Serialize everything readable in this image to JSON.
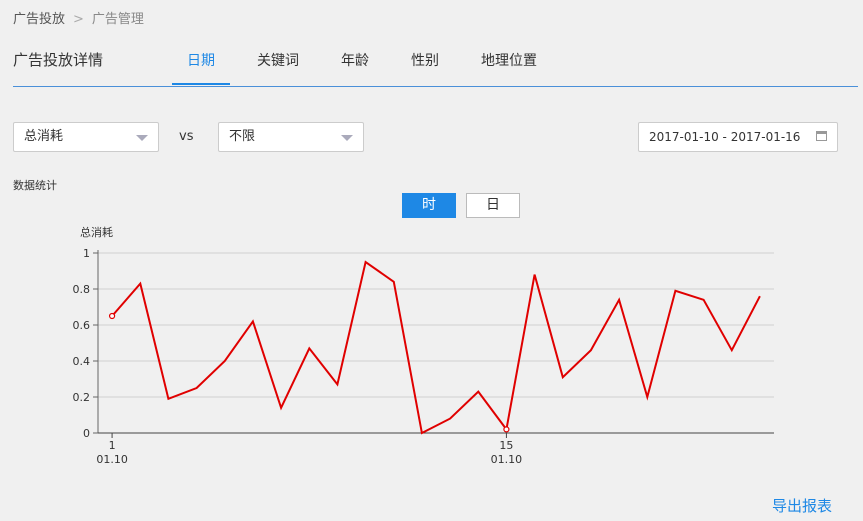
{
  "breadcrumb": {
    "root": "广告投放",
    "separator": ">",
    "current": "广告管理"
  },
  "page_title": "广告投放详情",
  "tabs": [
    {
      "label": "日期",
      "active": true
    },
    {
      "label": "关键词",
      "active": false
    },
    {
      "label": "年龄",
      "active": false
    },
    {
      "label": "性别",
      "active": false
    },
    {
      "label": "地理位置",
      "active": false
    }
  ],
  "filters": {
    "metric_a": "总消耗",
    "vs_label": "vs",
    "metric_b": "不限",
    "date_range": "2017-01-10 - 2017-01-16"
  },
  "section_label": "数据统计",
  "granularity": {
    "hour": "时",
    "day": "日",
    "selected": "时"
  },
  "export_label": "导出报表",
  "colors": {
    "accent": "#1e88e5",
    "series": "#e00000"
  },
  "chart_data": {
    "type": "line",
    "ylabel": "总消耗",
    "ylim": [
      0,
      1
    ],
    "yticks": [
      0,
      0.2,
      0.4,
      0.6,
      0.8,
      1
    ],
    "ytick_labels": [
      "0",
      "0.2",
      "0.4",
      "0.6",
      "0.8",
      "1"
    ],
    "x": [
      1,
      2,
      3,
      4,
      5,
      6,
      7,
      8,
      9,
      10,
      11,
      12,
      13,
      14,
      15,
      16,
      17,
      18,
      19,
      20,
      21,
      22,
      23,
      24
    ],
    "xlim": [
      0.5,
      24.5
    ],
    "xtick_labels": [
      {
        "x": 1,
        "line1": "1",
        "line2": "01.10"
      },
      {
        "x": 15,
        "line1": "15",
        "line2": "01.10"
      }
    ],
    "grid": true,
    "series": [
      {
        "values": [
          0.65,
          0.83,
          0.19,
          0.25,
          0.4,
          0.62,
          0.14,
          0.47,
          0.27,
          0.95,
          0.84,
          0.0,
          0.08,
          0.23,
          0.02,
          0.88,
          0.31,
          0.46,
          0.74,
          0.2,
          0.79,
          0.74,
          0.46,
          0.76
        ],
        "markers_at": [
          1,
          15
        ]
      }
    ]
  }
}
